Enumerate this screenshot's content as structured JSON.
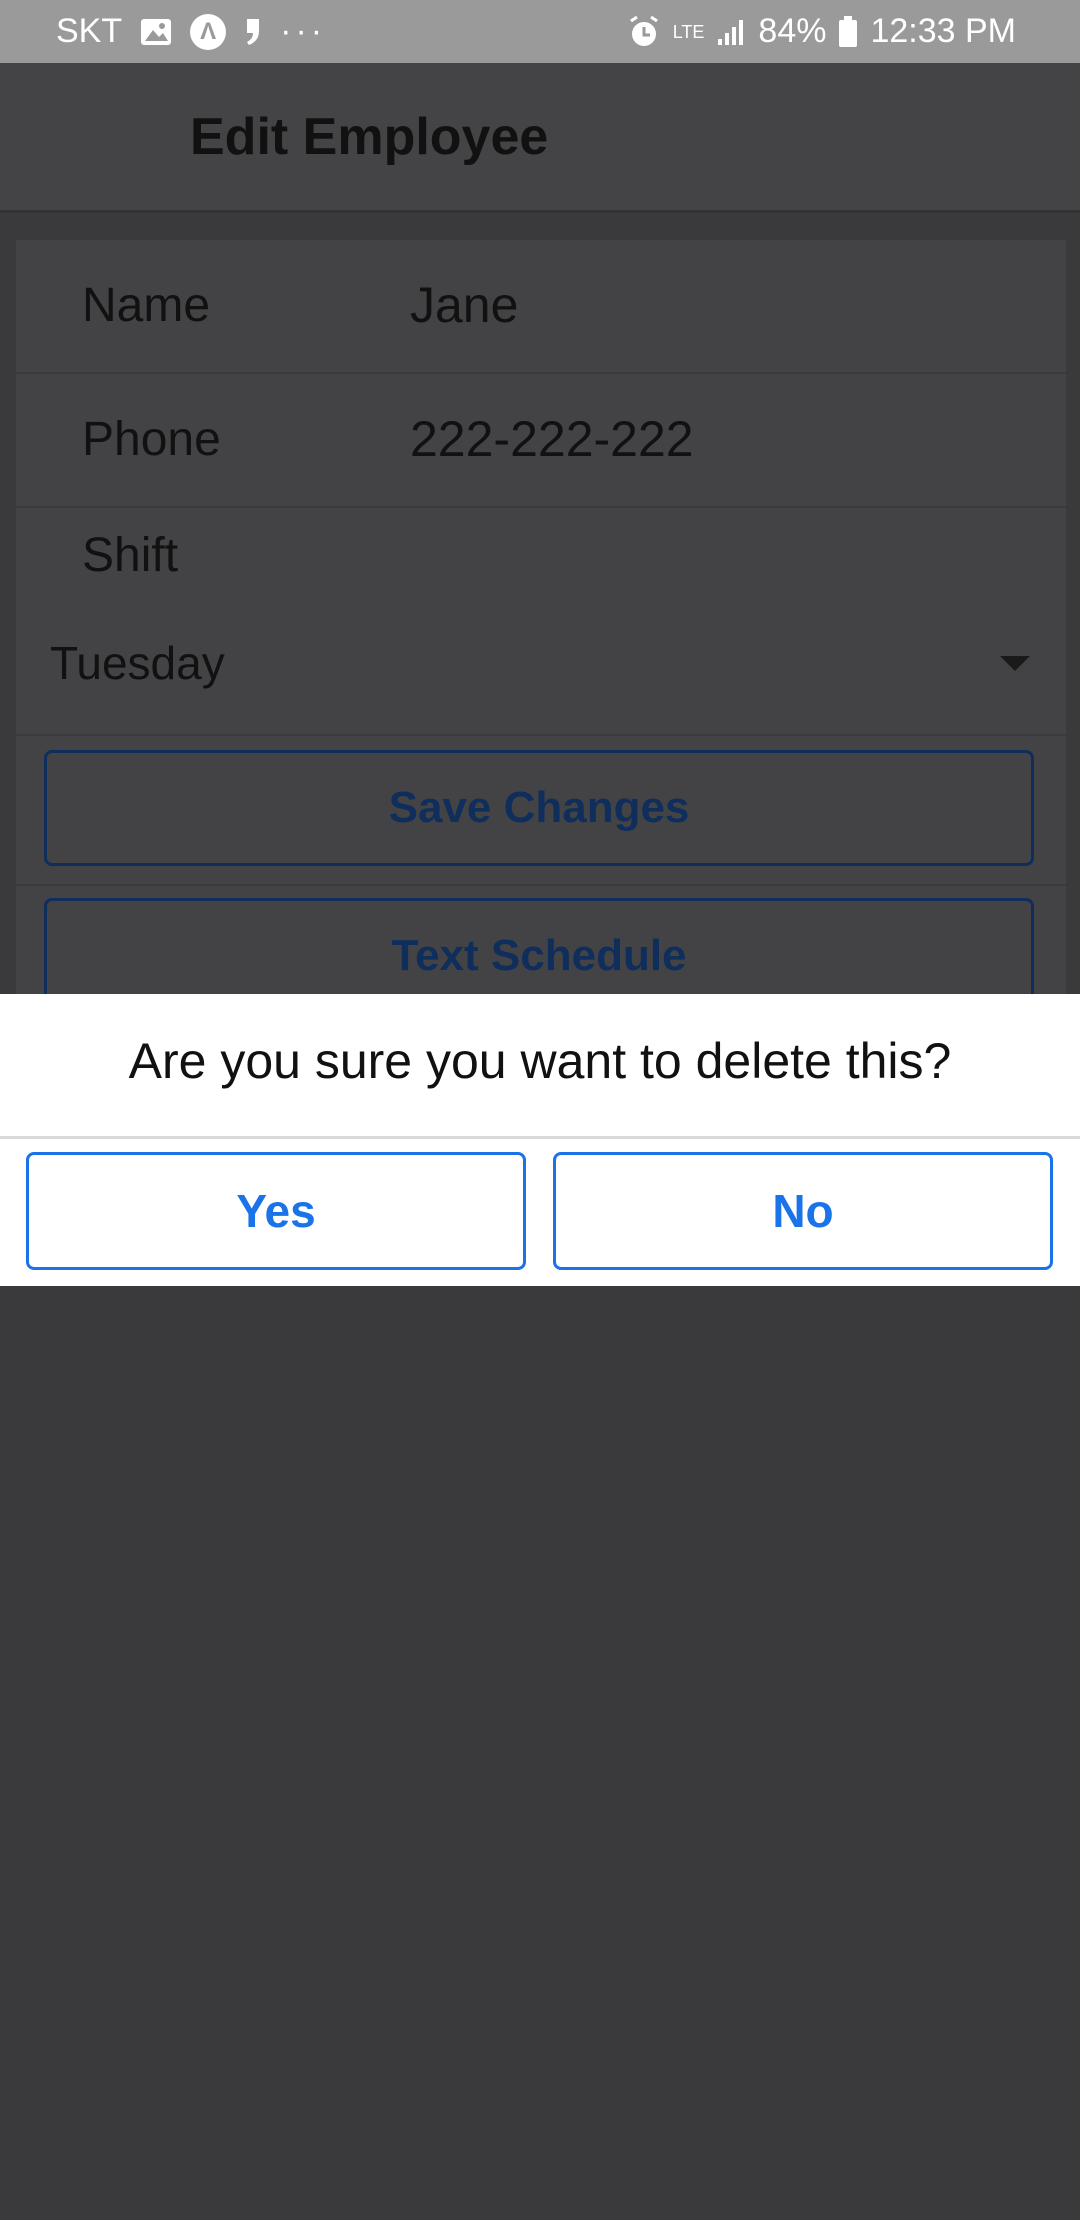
{
  "status_bar": {
    "carrier": "SKT",
    "left_icons": [
      "image-icon",
      "app-a-icon",
      "quote-icon",
      "more-dots-icon"
    ],
    "network": "LTE",
    "battery": "84%",
    "time": "12:33 PM"
  },
  "app_bar": {
    "title": "Edit Employee"
  },
  "form": {
    "name_label": "Name",
    "name_value": "Jane",
    "phone_label": "Phone",
    "phone_value": "222-222-222",
    "shift_label": "Shift",
    "shift_value": "Tuesday",
    "save_label": "Save Changes",
    "text_schedule_label": "Text Schedule"
  },
  "dialog": {
    "message": "Are you sure you want to delete this?",
    "yes_label": "Yes",
    "no_label": "No"
  },
  "colors": {
    "accent": "#1a73e8",
    "overlay": "#3a3a3c",
    "status_bar": "#9a9a9a"
  }
}
